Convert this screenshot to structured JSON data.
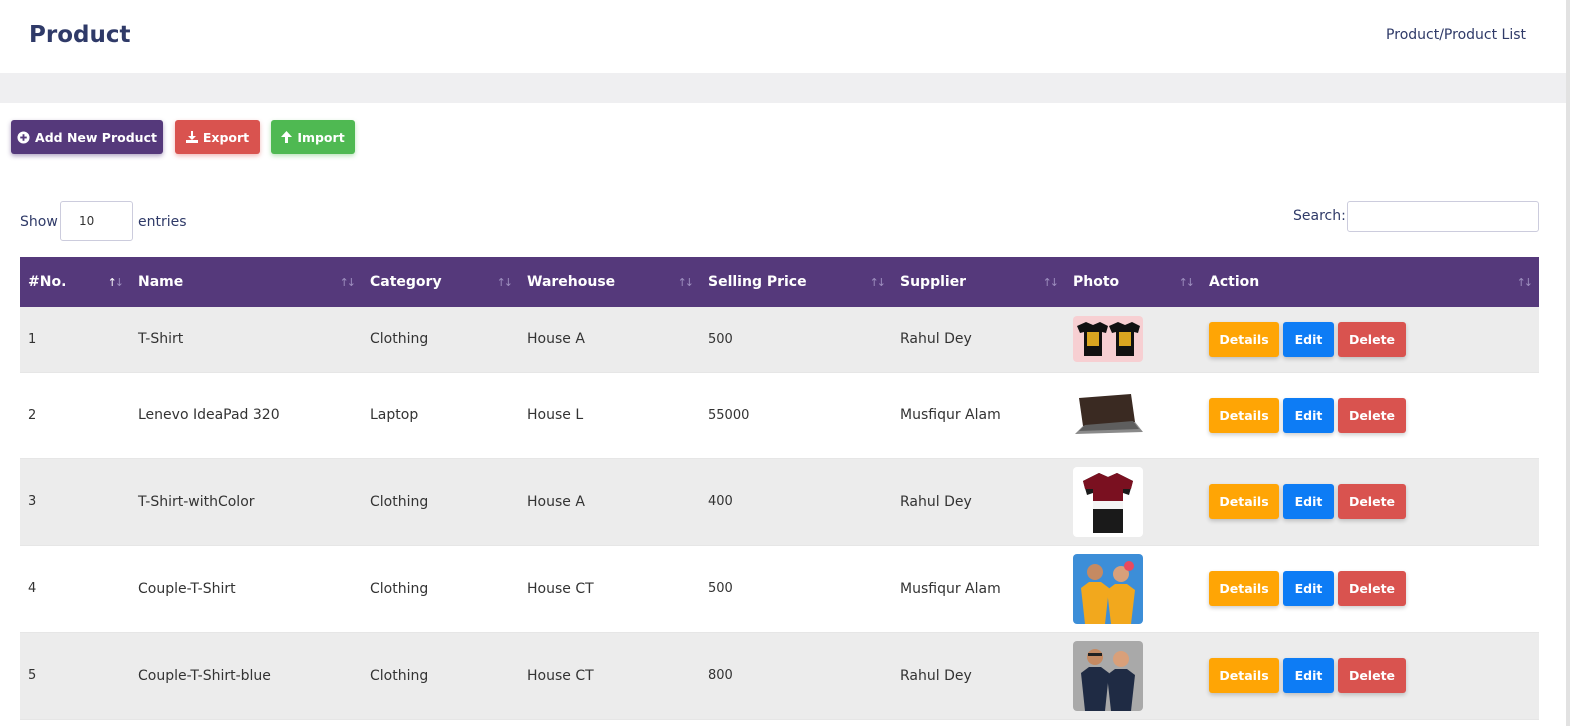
{
  "header": {
    "title": "Product",
    "breadcrumb": "Product/Product List"
  },
  "toolbar": {
    "add_label": "Add New Product",
    "export_label": "Export",
    "import_label": "Import"
  },
  "length_control": {
    "show_label": "Show",
    "value": "10",
    "entries_label": "entries"
  },
  "search": {
    "label": "Search:",
    "value": ""
  },
  "table": {
    "columns": [
      "#No.",
      "Name",
      "Category",
      "Warehouse",
      "Selling Price",
      "Supplier",
      "Photo",
      "Action"
    ],
    "sorted_column": "#No.",
    "sort_icon": "↑↓",
    "action_labels": {
      "details": "Details",
      "edit": "Edit",
      "delete": "Delete"
    },
    "rows": [
      {
        "no": "1",
        "name": "T-Shirt",
        "category": "Clothing",
        "warehouse": "House A",
        "price": "500",
        "supplier": "Rahul Dey",
        "photo": "black-tshirts-photo"
      },
      {
        "no": "2",
        "name": "Lenevo IdeaPad 320",
        "category": "Laptop",
        "warehouse": "House L",
        "price": "55000",
        "supplier": "Musfiqur Alam",
        "photo": "laptop-photo"
      },
      {
        "no": "3",
        "name": "T-Shirt-withColor",
        "category": "Clothing",
        "warehouse": "House A",
        "price": "400",
        "supplier": "Rahul Dey",
        "photo": "polo-shirt-photo"
      },
      {
        "no": "4",
        "name": "Couple-T-Shirt",
        "category": "Clothing",
        "warehouse": "House CT",
        "price": "500",
        "supplier": "Musfiqur Alam",
        "photo": "couple-yellow-tshirts-photo"
      },
      {
        "no": "5",
        "name": "Couple-T-Shirt-blue",
        "category": "Clothing",
        "warehouse": "House CT",
        "price": "800",
        "supplier": "Rahul Dey",
        "photo": "couple-navy-tshirts-photo"
      }
    ]
  },
  "colors": {
    "primary": "#55397b",
    "danger": "#d9534f",
    "success": "#4fb952",
    "warning": "#ffa505",
    "info": "#0d7cf5",
    "title": "#2f3a68"
  }
}
